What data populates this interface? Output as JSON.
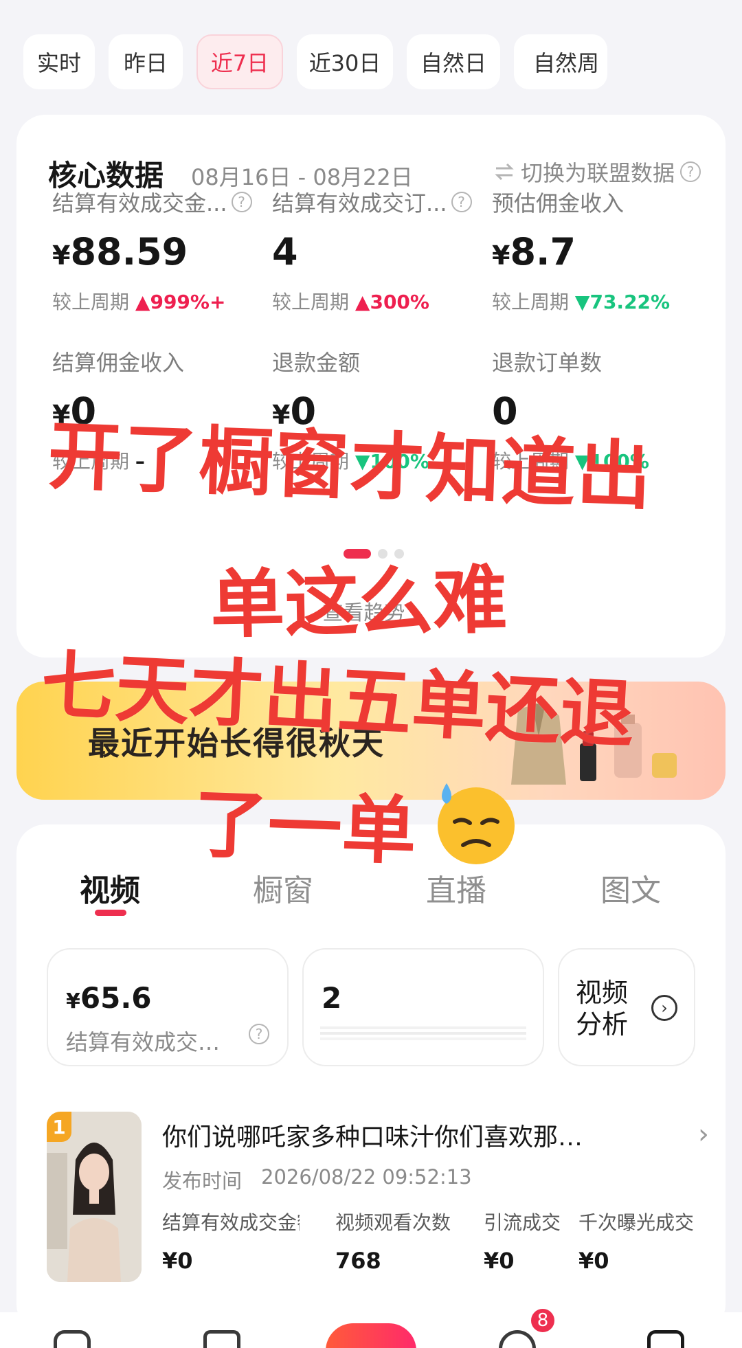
{
  "period_tabs": [
    {
      "label": "实时",
      "active": false
    },
    {
      "label": "昨日",
      "active": false
    },
    {
      "label": "近7日",
      "active": true
    },
    {
      "label": "近30日",
      "active": false
    },
    {
      "label": "自然日",
      "active": false
    },
    {
      "label": "自然周",
      "active": false
    }
  ],
  "core": {
    "title": "核心数据",
    "date_range": "08月16日 - 08月22日",
    "switch_label": "切换为联盟数据",
    "compare_prefix": "较上周期",
    "metrics": [
      {
        "label": "结算有效成交金...",
        "value": "88.59",
        "currency": "¥",
        "change": "999%+",
        "direction": "up"
      },
      {
        "label": "结算有效成交订...",
        "value": "4",
        "currency": "",
        "change": "300%",
        "direction": "up"
      },
      {
        "label": "预估佣金收入",
        "value": "8.7",
        "currency": "¥",
        "change": "73.22%",
        "direction": "down"
      },
      {
        "label": "结算佣金收入",
        "value": "0",
        "currency": "¥",
        "change": "–",
        "direction": "none"
      },
      {
        "label": "退款金额",
        "value": "0",
        "currency": "¥",
        "change": "100%",
        "direction": "down"
      },
      {
        "label": "退款订单数",
        "value": "0",
        "currency": "",
        "change": "100%",
        "direction": "down"
      }
    ],
    "trend_link": "查看趋势 ›"
  },
  "banner": {
    "text": "最近开始长得很秋天"
  },
  "content": {
    "tabs": [
      {
        "label": "视频",
        "active": true
      },
      {
        "label": "橱窗",
        "active": false
      },
      {
        "label": "直播",
        "active": false
      },
      {
        "label": "图文",
        "active": false
      }
    ],
    "stats": {
      "amount": {
        "currency": "¥",
        "value": "65.6",
        "label": "结算有效成交…"
      },
      "count": {
        "value": "2"
      },
      "analysis_label": "视频分析"
    },
    "video": {
      "rank": "1",
      "title": "你们说哪吒家多种口味汁你们喜欢那…",
      "date_label": "发布时间",
      "date": "2026/08/22 09:52:13",
      "metrics": [
        {
          "label": "结算有效成交金额",
          "value": "¥0"
        },
        {
          "label": "视频观看次数",
          "value": "768"
        },
        {
          "label": "引流成交",
          "value": "¥0"
        },
        {
          "label": "千次曝光成交",
          "value": "¥0"
        }
      ]
    }
  },
  "bottom_nav": {
    "badge": "8"
  },
  "overlay": {
    "line1": "开了橱窗才知道出",
    "line2": "单这么难",
    "line3": "七天才出五单还退",
    "line4": "了一单"
  },
  "colors": {
    "accent": "#ee2f4f",
    "up": "#ee1f4f",
    "down": "#18c47e",
    "overlay_text": "#ee3a34"
  }
}
